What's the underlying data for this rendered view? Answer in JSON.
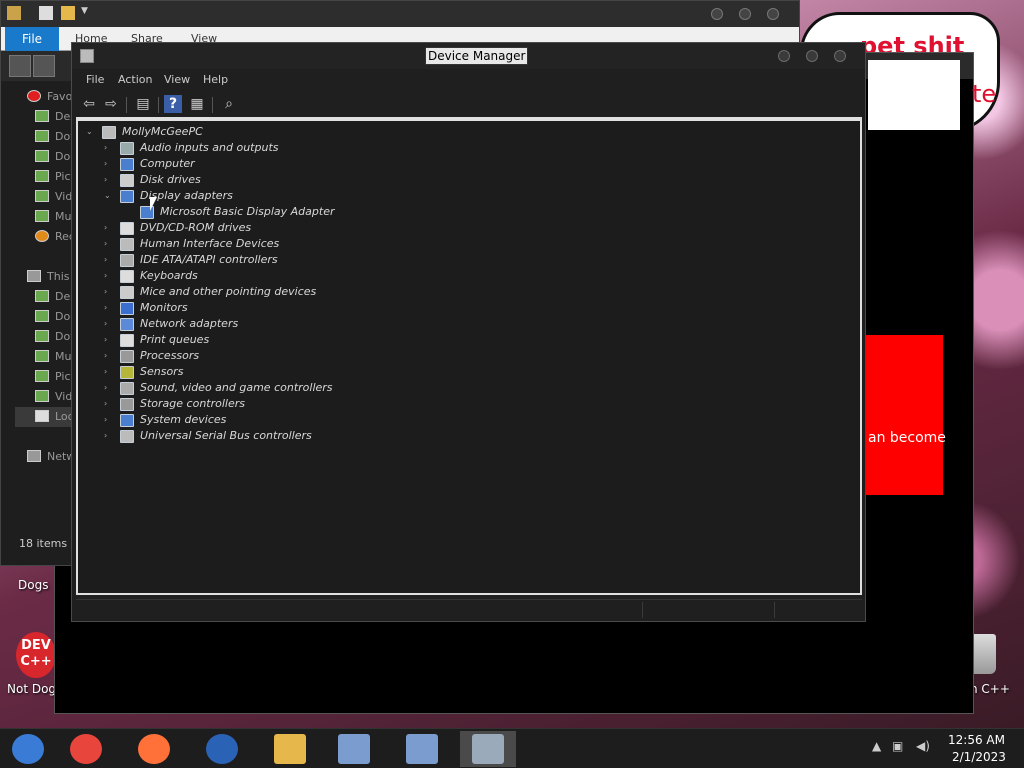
{
  "desktop": {
    "wallpaper_text": "pet shit",
    "icons": [
      {
        "label": "Dogs"
      },
      {
        "label": "Not Dog"
      },
      {
        "label": "n C++"
      }
    ],
    "devcpp_logo_text": "DEV C++"
  },
  "background_window": {
    "white_text": "te",
    "red_dialog_text": "an become"
  },
  "explorer": {
    "file_tab": "File",
    "tabs": [
      "Home",
      "Share",
      "View"
    ],
    "sidebar": [
      {
        "label": "Favo",
        "icon": "heart-icon"
      },
      {
        "label": "Des",
        "icon": "desktop-folder-icon"
      },
      {
        "label": "Dov",
        "icon": "downloads-folder-icon"
      },
      {
        "label": "Doc",
        "icon": "documents-folder-icon"
      },
      {
        "label": "Pict",
        "icon": "pictures-folder-icon"
      },
      {
        "label": "Vid",
        "icon": "videos-folder-icon"
      },
      {
        "label": "Mu",
        "icon": "music-folder-icon"
      },
      {
        "label": "Rec",
        "icon": "recent-places-icon"
      },
      {
        "label": "This I",
        "icon": "computer-icon"
      },
      {
        "label": "Des",
        "icon": "desktop-folder-icon"
      },
      {
        "label": "Doc",
        "icon": "documents-folder-icon"
      },
      {
        "label": "Dov",
        "icon": "downloads-folder-icon"
      },
      {
        "label": "Mu",
        "icon": "music-folder-icon"
      },
      {
        "label": "Pict",
        "icon": "pictures-folder-icon"
      },
      {
        "label": "Vid",
        "icon": "videos-folder-icon"
      },
      {
        "label": "Loc",
        "icon": "local-disk-icon"
      },
      {
        "label": "Netw",
        "icon": "network-icon"
      }
    ],
    "status": "18 items"
  },
  "device_manager": {
    "title": "Device Manager",
    "menu": [
      "File",
      "Action",
      "View",
      "Help"
    ],
    "toolbar": [
      {
        "name": "back-icon",
        "glyph": "⇦"
      },
      {
        "name": "forward-icon",
        "glyph": "⇨"
      },
      {
        "name": "properties-icon",
        "glyph": "▤"
      },
      {
        "name": "help-icon",
        "glyph": "?"
      },
      {
        "name": "view-icon",
        "glyph": "▦"
      },
      {
        "name": "scan-hardware-icon",
        "glyph": "⌕"
      }
    ],
    "tree_root": "MollyMcGeePC",
    "categories": [
      {
        "label": "Audio inputs and outputs",
        "expanded": false,
        "icon": "speaker-icon"
      },
      {
        "label": "Computer",
        "expanded": false,
        "icon": "computer-icon"
      },
      {
        "label": "Disk drives",
        "expanded": false,
        "icon": "disk-drive-icon"
      },
      {
        "label": "Display adapters",
        "expanded": true,
        "icon": "display-adapter-icon",
        "children": [
          {
            "label": "Microsoft Basic Display Adapter",
            "icon": "display-adapter-icon"
          }
        ]
      },
      {
        "label": "DVD/CD-ROM drives",
        "expanded": false,
        "icon": "dvd-drive-icon"
      },
      {
        "label": "Human Interface Devices",
        "expanded": false,
        "icon": "hid-icon"
      },
      {
        "label": "IDE ATA/ATAPI controllers",
        "expanded": false,
        "icon": "ide-controller-icon"
      },
      {
        "label": "Keyboards",
        "expanded": false,
        "icon": "keyboard-icon"
      },
      {
        "label": "Mice and other pointing devices",
        "expanded": false,
        "icon": "mouse-icon"
      },
      {
        "label": "Monitors",
        "expanded": false,
        "icon": "monitor-icon"
      },
      {
        "label": "Network adapters",
        "expanded": false,
        "icon": "network-adapter-icon"
      },
      {
        "label": "Print queues",
        "expanded": false,
        "icon": "printer-icon"
      },
      {
        "label": "Processors",
        "expanded": false,
        "icon": "processor-icon"
      },
      {
        "label": "Sensors",
        "expanded": false,
        "icon": "sensor-icon"
      },
      {
        "label": "Sound, video and game controllers",
        "expanded": false,
        "icon": "sound-icon"
      },
      {
        "label": "Storage controllers",
        "expanded": false,
        "icon": "storage-controller-icon"
      },
      {
        "label": "System devices",
        "expanded": false,
        "icon": "system-devices-icon"
      },
      {
        "label": "Universal Serial Bus controllers",
        "expanded": false,
        "icon": "usb-icon"
      }
    ]
  },
  "taskbar": {
    "apps": [
      {
        "name": "chrome-remote-icon",
        "color": "#3a7bd5"
      },
      {
        "name": "chrome-icon",
        "color": "#e8453c"
      },
      {
        "name": "firefox-icon",
        "color": "#ff7139"
      },
      {
        "name": "obama-logo-icon",
        "color": "#2a62b5"
      },
      {
        "name": "file-explorer-icon",
        "color": "#e6b84c"
      },
      {
        "name": "device-manager-icon-1",
        "color": "#7a9ccf"
      },
      {
        "name": "device-manager-icon-2",
        "color": "#7a9ccf"
      },
      {
        "name": "device-manager-icon-3",
        "color": "#9aaabb"
      }
    ],
    "time": "12:56 AM",
    "date": "2/1/2023"
  }
}
